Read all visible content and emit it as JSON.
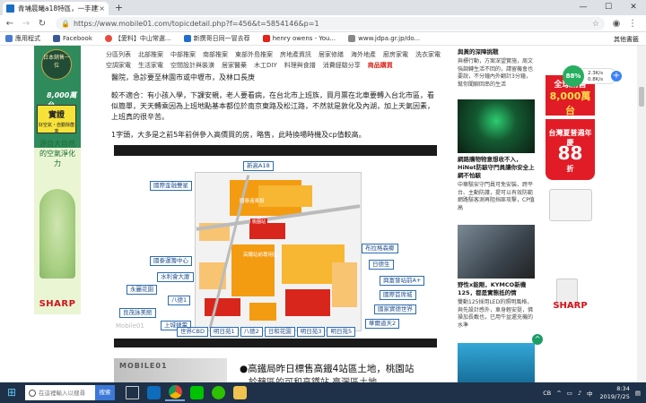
{
  "browser": {
    "tab_title": "青埔晨曦a18特區，一手建案資",
    "tab_close": "×",
    "new_tab": "+",
    "minimize": "—",
    "maximize": "☐",
    "close": "✕",
    "url": "https://www.mobile01.com/topicdetail.php?f=456&t=5854146&p=1",
    "bookmarks": [
      {
        "label": "應用程式",
        "color": "#4a7bd1"
      },
      {
        "label": "Facebook",
        "color": "#3b5998"
      },
      {
        "label": "【愛料】中山常選...",
        "color": "#e74c3c"
      },
      {
        "label": "新撰哥日同一冒去荐",
        "color": "#1f6fcf"
      },
      {
        "label": "henry owens - You...",
        "color": "#e62117"
      },
      {
        "label": "www.jdpa.gr.jp/do...",
        "color": "#888888"
      }
    ],
    "bookmarks_other": "其他書籤"
  },
  "subnav": {
    "row1": [
      "分區列表",
      "北部推案",
      "中部推案",
      "南部推案",
      "東部外島推案",
      "房地產資訊",
      "居家修繕",
      "海外地產",
      "廚房家電",
      "洗衣家電"
    ],
    "row2": [
      "空調家電",
      "生活家電",
      "空間設計與裝潢",
      "居家醫藥",
      "木工DIY",
      "料理與食譜",
      "消費經驗分享"
    ],
    "row2_hot": "商品購買"
  },
  "article": {
    "p0": "醫院，急診要至林園市或中壢市，及林口長庚",
    "p1": "較不適合：有小孩入學，下課安親，老人要看病，在台北市上班族，買月票在北車要轉入台北市區，看似簡單，天天轉乘因為上班地點基本都位於南京東路及松江路，不然就是敦化及內湖，加上天氣因素，上班真的很辛苦。",
    "p2": "1字頭，大多是之前5年前併參入高價買的房，略售，此時換場時機及cp值較高。"
  },
  "map": {
    "labels_top": [
      "新高A18",
      "國際金融雙星"
    ],
    "labels_left": [
      "國泰運籌中心",
      "水利會大廈",
      "永麗花園",
      "八德1",
      "良茂詠美館",
      "上城捷電"
    ],
    "labels_right": [
      "布拉格森鄉",
      "日德生",
      "興富發站前A+",
      "國際首席城",
      "國家實德世界",
      "華爾道天2"
    ],
    "labels_bottom": [
      "世界CBD",
      "明日苑1",
      "八德2",
      "日和花園",
      "明日苑3",
      "明日苑5"
    ],
    "zone_labels": [
      "國泰遠東設",
      "高鐵站前專用區",
      "桃園站"
    ],
    "watermark": "Mobile01"
  },
  "article2": {
    "logo": "MOBILE01",
    "headline": "●高鐵局昨日標售高鐵4站區土地，桃園站",
    "line2": "於轄區的可和高鐵站 臺灣區土地，"
  },
  "sidebar": {
    "news": [
      {
        "head": "與黃的深障挑戰",
        "desc": "與標行動，方案深望實施，周文強調轉生活不回的，請留機會也要說，不分鐘內外翻計3分鐘，幫你聞聊回串的生活",
        "color": "#2a3f5f"
      },
      {
        "head": "網路購物物意想收不入，HiNet防駭守門員讓你安全上網不怕駭",
        "desc": "中華駭安守門員可免安裝、跨平台、主動防護，提可以有效防範網路駭客測再阻挡匪攻擊，CP值高",
        "color": "#0d2b1a"
      },
      {
        "head": "野性x能剛，KYMCO新機125，都是實態抵的情",
        "desc": "雙動125採用LED的照明風格，與先設計感外，車身輕安挺，佛操加長載也，已用牛盆還充機的水準",
        "color": "#4a5560"
      },
      {
        "head": "",
        "desc": "",
        "color": "#1a7fb0"
      }
    ]
  },
  "rightad": {
    "brand": "SHARP",
    "line1": "全球銷售",
    "line1b": "8,000萬台",
    "line2": "台灣夏普週年慶",
    "line2b": "88",
    "line2c": "折"
  },
  "leftad": {
    "clock_text": "日本銷售一位",
    "badge": "8,000萬台",
    "yellow": "實證",
    "yellow_sub": "好空氣・自動除菌率",
    "green": "源自大自然的空氣淨化力",
    "brand": "SHARP"
  },
  "widget": {
    "pct": "88%",
    "up": "2.3K/s",
    "down": "0.8K/s"
  },
  "taskbar": {
    "search_placeholder": "在這裡輸入以搜尋",
    "search_btn": "搜索",
    "tray_lang": "CB",
    "time": "8:34",
    "date": "2019/7/25"
  },
  "colors": {
    "accent": "#1a6fc2",
    "map_orange": "#f39c12",
    "map_red": "#d9261c",
    "map_blue_label": "#2b6cb0"
  }
}
